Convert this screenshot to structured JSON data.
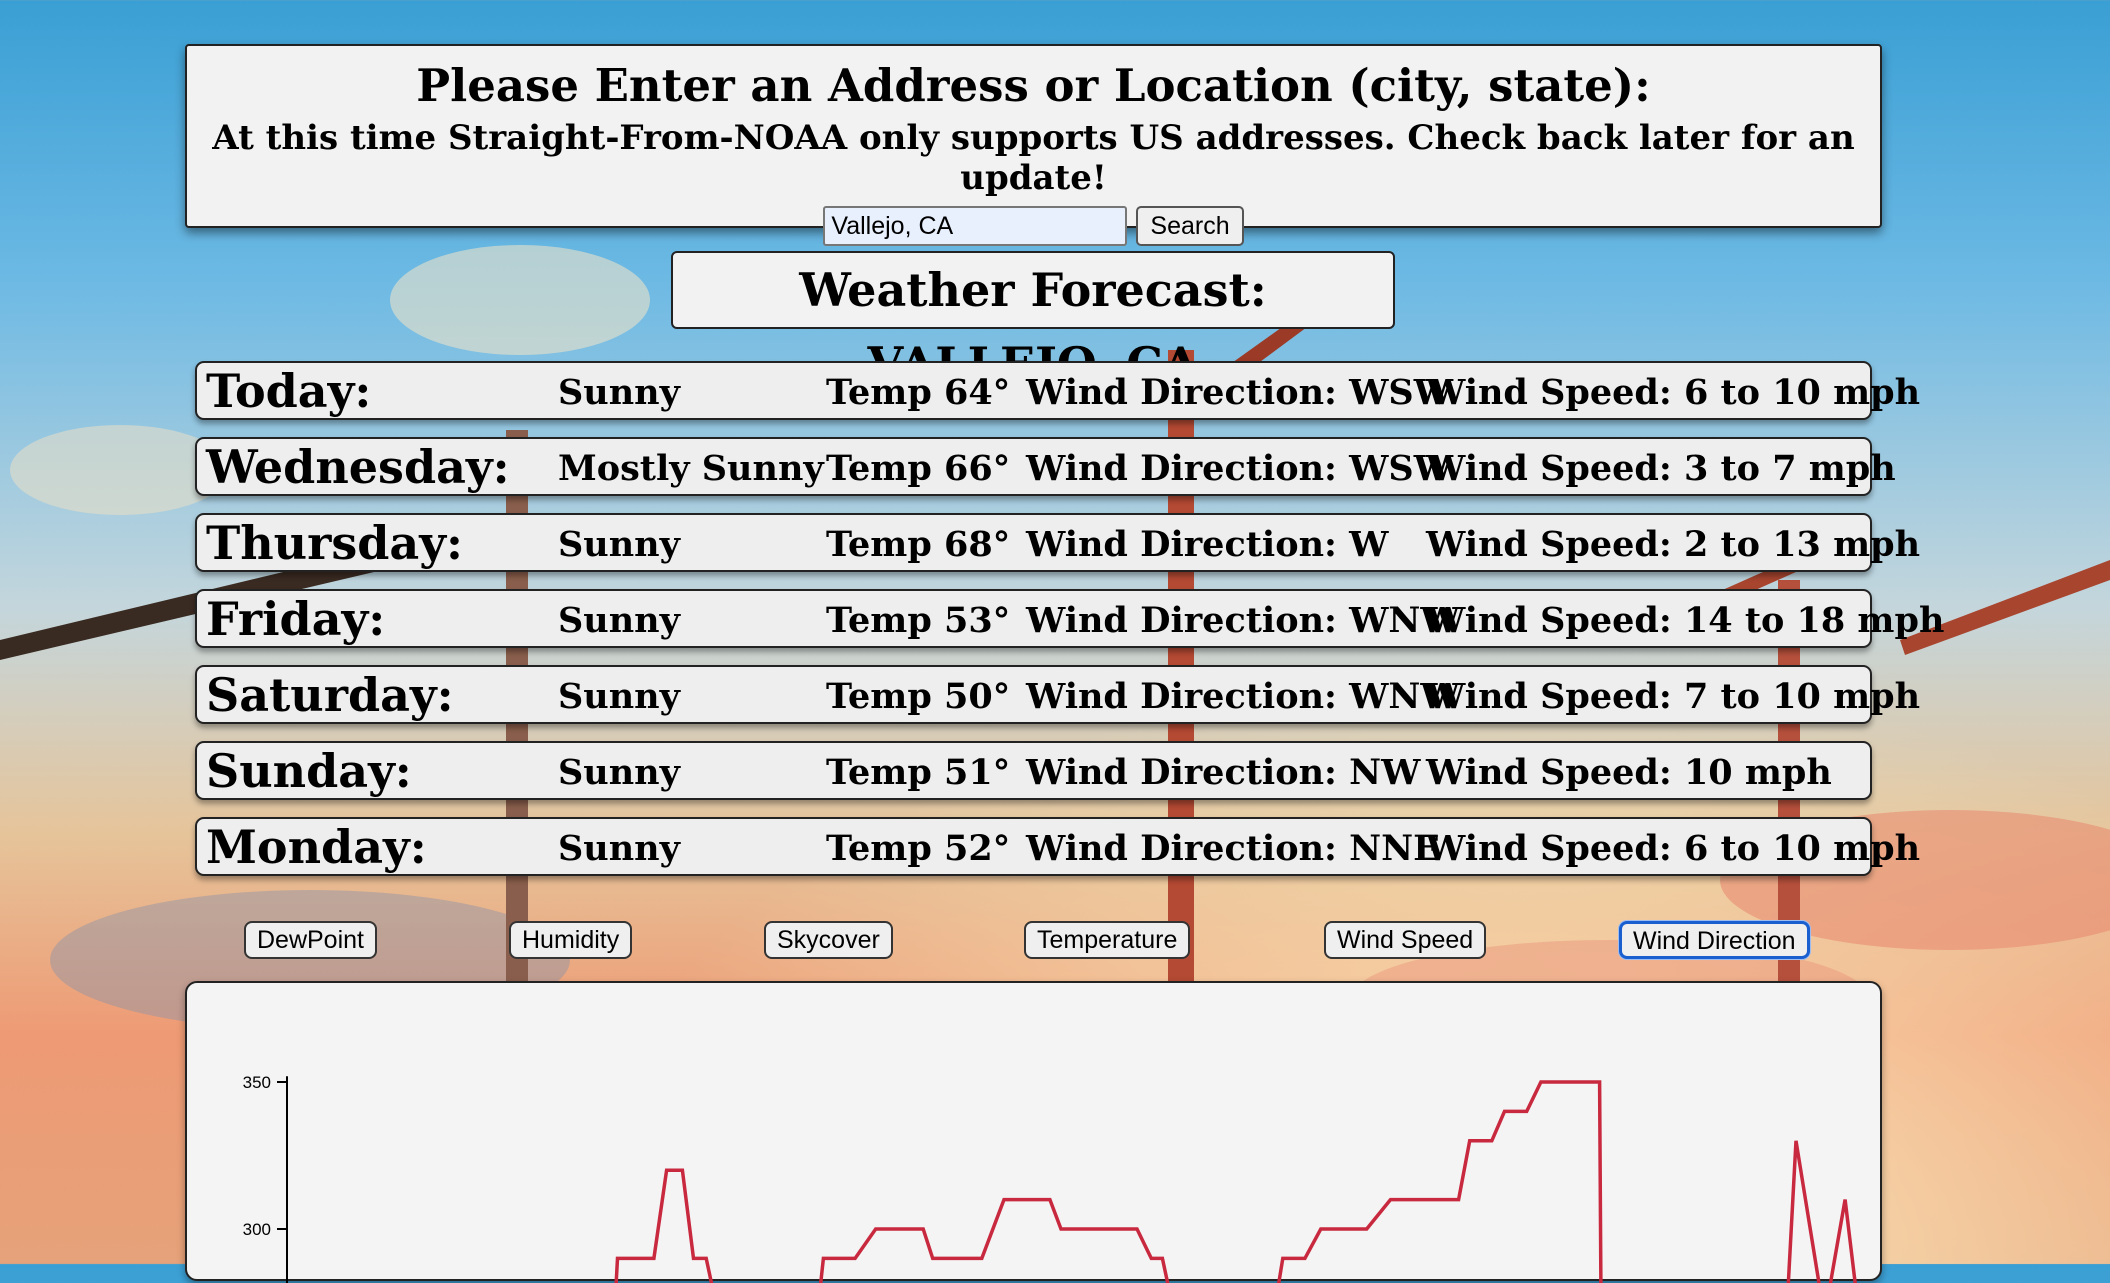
{
  "search": {
    "title": "Please Enter an Address or Location (city, state):",
    "subtitle": "At this time Straight-From-NOAA only supports US addresses. Check back later for an update!",
    "input_value": "Vallejo, CA",
    "button_label": "Search"
  },
  "forecast": {
    "title": "Weather Forecast: VALLEJO, CA",
    "days": [
      {
        "day": "Today:",
        "condition": "Sunny",
        "temp": "Temp 64°",
        "wind_direction": "Wind Direction: WSW",
        "wind_speed": "Wind Speed: 6 to 10 mph"
      },
      {
        "day": "Wednesday:",
        "condition": "Mostly Sunny",
        "temp": "Temp 66°",
        "wind_direction": "Wind Direction: WSW",
        "wind_speed": "Wind Speed: 3 to 7 mph"
      },
      {
        "day": "Thursday:",
        "condition": "Sunny",
        "temp": "Temp 68°",
        "wind_direction": "Wind Direction: W",
        "wind_speed": "Wind Speed: 2 to 13 mph"
      },
      {
        "day": "Friday:",
        "condition": "Sunny",
        "temp": "Temp 53°",
        "wind_direction": "Wind Direction: WNW",
        "wind_speed": "Wind Speed: 14 to 18 mph"
      },
      {
        "day": "Saturday:",
        "condition": "Sunny",
        "temp": "Temp 50°",
        "wind_direction": "Wind Direction: WNW",
        "wind_speed": "Wind Speed: 7 to 10 mph"
      },
      {
        "day": "Sunday:",
        "condition": "Sunny",
        "temp": "Temp 51°",
        "wind_direction": "Wind Direction: NW",
        "wind_speed": "Wind Speed: 10 mph"
      },
      {
        "day": "Monday:",
        "condition": "Sunny",
        "temp": "Temp 52°",
        "wind_direction": "Wind Direction: NNE",
        "wind_speed": "Wind Speed: 6 to 10 mph"
      }
    ]
  },
  "chart_buttons": {
    "dewpoint": "DewPoint",
    "humidity": "Humidity",
    "skycover": "Skycover",
    "temperature": "Temperature",
    "wind_speed": "Wind Speed",
    "wind_direction": "Wind Direction",
    "active": "Wind Direction"
  },
  "colors": {
    "series": "#c8293f",
    "active_button_border": "#1a5fd0"
  },
  "chart_data": {
    "type": "line",
    "title": "",
    "xlabel": "",
    "ylabel": "",
    "yticks": [
      350,
      300
    ],
    "ylim": [
      270,
      355
    ],
    "x_range": [
      0,
      100
    ],
    "series": [
      {
        "color": "#c8293f",
        "points": [
          [
            19.5,
            280
          ],
          [
            20.7,
            280
          ],
          [
            20.8,
            290
          ],
          [
            23.1,
            290
          ],
          [
            23.9,
            320
          ],
          [
            24.9,
            320
          ],
          [
            25.6,
            290
          ],
          [
            26.4,
            290
          ],
          [
            26.8,
            280
          ],
          [
            33.6,
            280
          ],
          [
            33.8,
            290
          ],
          [
            35.8,
            290
          ],
          [
            37.1,
            300
          ],
          [
            40.1,
            300
          ],
          [
            40.7,
            290
          ],
          [
            43.8,
            290
          ],
          [
            45.2,
            310
          ],
          [
            48.1,
            310
          ],
          [
            48.8,
            300
          ],
          [
            53.6,
            300
          ],
          [
            54.5,
            290
          ],
          [
            55.2,
            290
          ],
          [
            55.6,
            280
          ],
          [
            62.5,
            280
          ],
          [
            62.8,
            290
          ],
          [
            64.2,
            290
          ],
          [
            65.2,
            300
          ],
          [
            68.1,
            300
          ],
          [
            69.6,
            310
          ],
          [
            73.9,
            310
          ],
          [
            74.6,
            330
          ],
          [
            76.0,
            330
          ],
          [
            76.8,
            340
          ],
          [
            78.2,
            340
          ],
          [
            79.1,
            350
          ],
          [
            82.8,
            350
          ],
          [
            82.9,
            270
          ],
          [
            94.6,
            270
          ],
          [
            95.2,
            330
          ],
          [
            97.0,
            270
          ],
          [
            98.3,
            310
          ],
          [
            99.2,
            270
          ]
        ]
      }
    ]
  }
}
